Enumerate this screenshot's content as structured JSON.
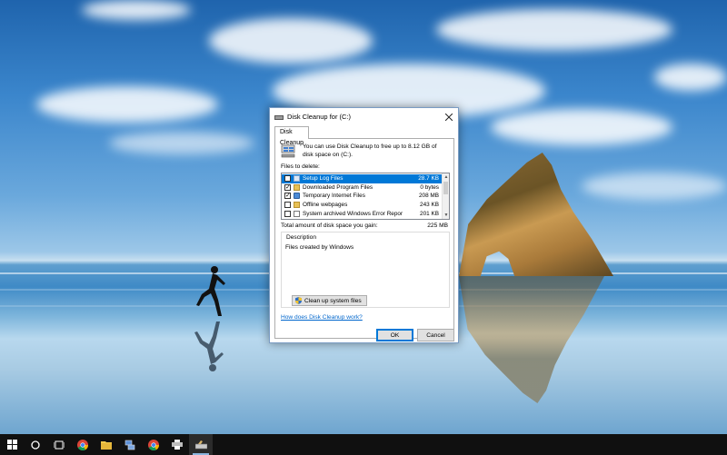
{
  "dialog": {
    "title": "Disk Cleanup for  (C:)",
    "tab": "Disk Cleanup",
    "intro": "You can use Disk Cleanup to free up to 8.12 GB of disk space on  (C:).",
    "files_label": "Files to delete:",
    "files": [
      {
        "name": "Setup Log Files",
        "size": "28.7 KB",
        "checked": false,
        "selected": true,
        "icon": "setup-log-icon"
      },
      {
        "name": "Downloaded Program Files",
        "size": "0 bytes",
        "checked": true,
        "selected": false,
        "icon": "folder-icon"
      },
      {
        "name": "Temporary Internet Files",
        "size": "208 MB",
        "checked": true,
        "selected": false,
        "icon": "lock-file-icon"
      },
      {
        "name": "Offline webpages",
        "size": "243 KB",
        "checked": false,
        "selected": false,
        "icon": "folder-icon"
      },
      {
        "name": "System archived Windows Error Repor...",
        "size": "201 KB",
        "checked": false,
        "selected": false,
        "icon": "file-icon"
      }
    ],
    "total_label": "Total amount of disk space you gain:",
    "total_value": "225 MB",
    "description_label": "Description",
    "description_text": "Files created by Windows",
    "cleanup_system_label": "Clean up system files",
    "help_link": "How does Disk Cleanup work?",
    "ok_label": "OK",
    "cancel_label": "Cancel"
  },
  "taskbar": {
    "items": [
      "start-icon",
      "cortana-icon",
      "task-view-icon",
      "chrome-icon",
      "file-explorer-icon",
      "network-app-icon",
      "chrome-icon",
      "printer-icon",
      "disk-cleanup-icon"
    ]
  },
  "colors": {
    "selection": "#0078d7",
    "link": "#0066cc",
    "taskbar": "#101010"
  }
}
